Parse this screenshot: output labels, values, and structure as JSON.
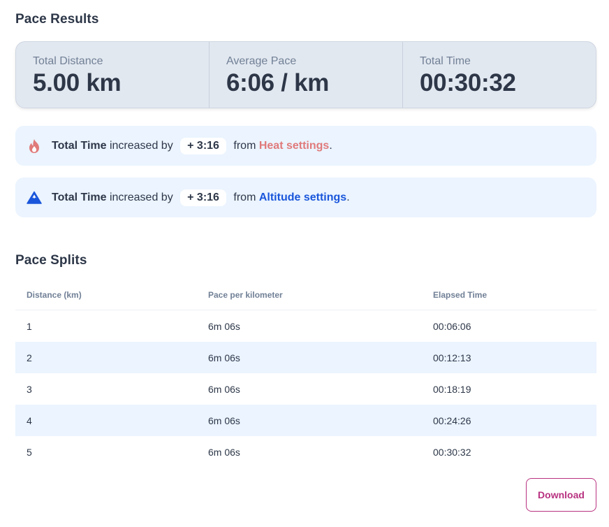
{
  "results": {
    "title": "Pace Results",
    "stats": [
      {
        "label": "Total Distance",
        "value": "5.00 km"
      },
      {
        "label": "Average Pace",
        "value": "6:06 / km"
      },
      {
        "label": "Total Time",
        "value": "00:30:32"
      }
    ]
  },
  "alerts": {
    "heat": {
      "icon": "flame-icon",
      "icon_color": "#e07a7a",
      "subject": "Total Time",
      "verb": " increased by ",
      "amount": "+ 3:16",
      "from": " from ",
      "link": "Heat settings",
      "end": "."
    },
    "altitude": {
      "icon": "mountain-icon",
      "icon_color": "#1a56db",
      "subject": "Total Time",
      "verb": " increased by ",
      "amount": "+ 3:16",
      "from": " from ",
      "link": "Altitude settings",
      "end": "."
    }
  },
  "splits": {
    "title": "Pace Splits",
    "columns": [
      "Distance (km)",
      "Pace per kilometer",
      "Elapsed Time"
    ],
    "rows": [
      [
        "1",
        "6m 06s",
        "00:06:06"
      ],
      [
        "2",
        "6m 06s",
        "00:12:13"
      ],
      [
        "3",
        "6m 06s",
        "00:18:19"
      ],
      [
        "4",
        "6m 06s",
        "00:24:26"
      ],
      [
        "5",
        "6m 06s",
        "00:30:32"
      ]
    ]
  },
  "actions": {
    "download_label": "Download",
    "accent_color": "#b83280"
  }
}
